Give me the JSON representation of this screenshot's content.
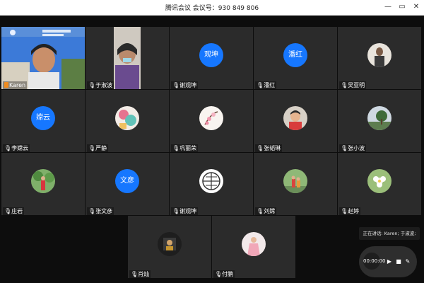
{
  "window": {
    "title": "腾讯会议 会议号：930 849 806",
    "minimize": "—",
    "restore": "▭",
    "close": "✕"
  },
  "participants": [
    {
      "name": "Karen",
      "kind": "camera",
      "host": true
    },
    {
      "name": "于淑波",
      "kind": "camera"
    },
    {
      "name": "谢观坤",
      "kind": "initials",
      "initials": "观坤"
    },
    {
      "name": "潘红",
      "kind": "initials",
      "initials": "潘红"
    },
    {
      "name": "吴亚明",
      "kind": "avatar",
      "avatar": "woman-photo"
    },
    {
      "name": "李嫦云",
      "kind": "initials",
      "initials": "嫦云"
    },
    {
      "name": "严静",
      "kind": "avatar",
      "avatar": "flower-drawing"
    },
    {
      "name": "巩丽荣",
      "kind": "avatar",
      "avatar": "blossom-drawing"
    },
    {
      "name": "张韬琳",
      "kind": "avatar",
      "avatar": "child-photo"
    },
    {
      "name": "张小波",
      "kind": "avatar",
      "avatar": "tree-photo"
    },
    {
      "name": "庄岩",
      "kind": "avatar",
      "avatar": "garden-person"
    },
    {
      "name": "张文彦",
      "kind": "initials",
      "initials": "文彦"
    },
    {
      "name": "谢观坤",
      "kind": "avatar",
      "avatar": "window-icon"
    },
    {
      "name": "刘嫦",
      "kind": "avatar",
      "avatar": "park-photo"
    },
    {
      "name": "赵婷",
      "kind": "avatar",
      "avatar": "flower-photo"
    },
    {
      "name": "肖灿",
      "kind": "avatar",
      "avatar": "dark-photo"
    },
    {
      "name": "付鹏",
      "kind": "avatar",
      "avatar": "pink-girl"
    }
  ],
  "speaking": "正在讲话: Karen; 于淑波;",
  "recording": {
    "time": "00:00:00",
    "play": "▶",
    "stop": "■",
    "edit": "✎"
  },
  "colors": {
    "accent": "#1677ff",
    "tile": "#2b2b2b",
    "background": "#0d0d0d"
  }
}
